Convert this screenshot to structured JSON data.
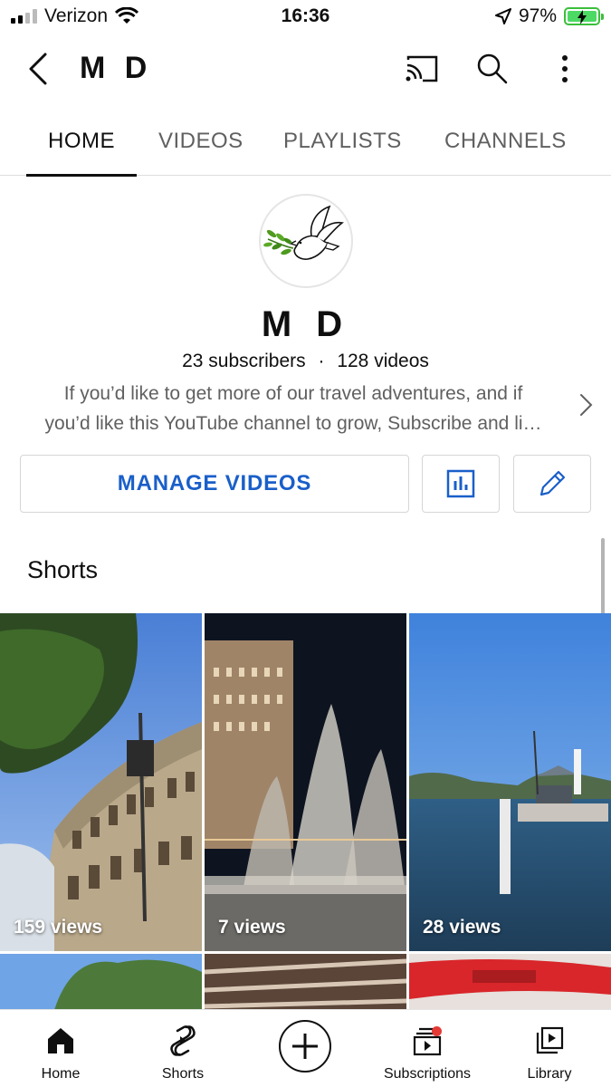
{
  "status_bar": {
    "carrier": "Verizon",
    "time": "16:36",
    "battery": "97%",
    "battery_color": "#4cd964"
  },
  "header": {
    "title": "M D",
    "icons": [
      "back-icon",
      "cast-icon",
      "search-icon",
      "more-icon"
    ]
  },
  "tabs": [
    {
      "label": "HOME",
      "active": true
    },
    {
      "label": "VIDEOS",
      "active": false
    },
    {
      "label": "PLAYLISTS",
      "active": false
    },
    {
      "label": "CHANNELS",
      "active": false
    }
  ],
  "channel": {
    "name": "M D",
    "subscribers": "23 subscribers",
    "separator": "·",
    "videos": "128 videos",
    "description_line1": "If you’d like to get more of our travel adventures, and if",
    "description_line2": "you’d like this YouTube channel to grow, Subscribe and li…"
  },
  "actions": {
    "manage_videos": "MANAGE VIDEOS",
    "analytics_icon": "analytics-icon",
    "edit_icon": "pencil-icon",
    "accent_color": "#1a5fc9"
  },
  "shorts": {
    "title": "Shorts",
    "items": [
      {
        "views": "159 views"
      },
      {
        "views": "7 views"
      },
      {
        "views": "28 views"
      }
    ]
  },
  "bottom_nav": {
    "items": [
      {
        "label": "Home",
        "icon": "home-icon"
      },
      {
        "label": "Shorts",
        "icon": "shorts-icon"
      },
      {
        "label": "",
        "icon": "create-icon"
      },
      {
        "label": "Subscriptions",
        "icon": "subscriptions-icon"
      },
      {
        "label": "Library",
        "icon": "library-icon"
      }
    ],
    "notification_color": "#e53935"
  }
}
